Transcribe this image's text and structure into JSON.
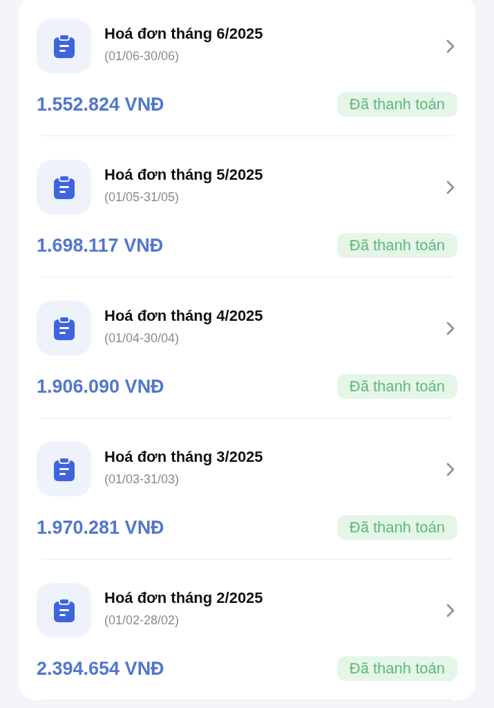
{
  "invoices": [
    {
      "title": "Hoá đơn tháng 6/2025",
      "period": "(01/06-30/06)",
      "amount": "1.552.824 VNĐ",
      "status": {
        "kind": "paid",
        "label": "Đã thanh toán"
      }
    },
    {
      "title": "Hoá đơn tháng 5/2025",
      "period": "(01/05-31/05)",
      "amount": "1.698.117 VNĐ",
      "status": {
        "kind": "paid",
        "label": "Đã thanh toán"
      }
    },
    {
      "title": "Hoá đơn tháng 4/2025",
      "period": "(01/04-30/04)",
      "amount": "1.906.090 VNĐ",
      "status": {
        "kind": "paid",
        "label": "Đã thanh toán"
      }
    },
    {
      "title": "Hoá đơn tháng 3/2025",
      "period": "(01/03-31/03)",
      "amount": "1.970.281 VNĐ",
      "status": {
        "kind": "paid",
        "label": "Đã thanh toán"
      }
    },
    {
      "title": "Hoá đơn tháng 2/2025",
      "period": "(01/02-28/02)",
      "amount": "2.394.654 VNĐ",
      "status": {
        "kind": "paid",
        "label": "Đã thanh toán"
      }
    }
  ]
}
